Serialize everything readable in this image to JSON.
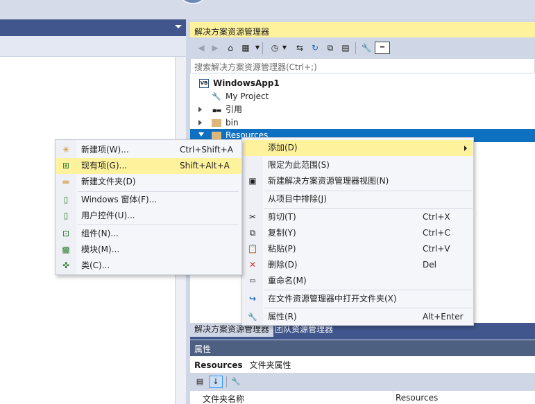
{
  "solution_explorer": {
    "title": "解决方案资源管理器",
    "search_placeholder": "搜索解决方案资源管理器(Ctrl+;)",
    "tree": {
      "project": "WindowsApp1",
      "project_badge": "VB",
      "items": [
        {
          "label": "My Project",
          "icon": "wrench-icon"
        },
        {
          "label": "引用",
          "icon": "references-icon"
        },
        {
          "label": "bin",
          "icon": "folder-icon"
        },
        {
          "label": "Resources",
          "icon": "folder-icon"
        }
      ]
    }
  },
  "bottom_tabs": [
    {
      "label": "解决方案资源管理器"
    },
    {
      "label": "团队资源管理器"
    }
  ],
  "properties": {
    "title": "属性",
    "object_name": "Resources",
    "object_type": "文件夹属性",
    "rows": [
      {
        "name": "文件夹名称",
        "value": "Resources"
      }
    ]
  },
  "context_menu": {
    "items": [
      {
        "label": "添加(D)",
        "shortcut": "",
        "icon": ""
      },
      {
        "label": "限定为此范围(S)",
        "shortcut": "",
        "icon": ""
      },
      {
        "label": "新建解决方案资源管理器视图(N)",
        "shortcut": "",
        "icon": "new-view-icon"
      },
      {
        "label": "从项目中排除(J)",
        "shortcut": "",
        "icon": ""
      },
      {
        "label": "剪切(T)",
        "shortcut": "Ctrl+X",
        "icon": "cut-icon"
      },
      {
        "label": "复制(Y)",
        "shortcut": "Ctrl+C",
        "icon": "copy-icon"
      },
      {
        "label": "粘贴(P)",
        "shortcut": "Ctrl+V",
        "icon": "paste-icon"
      },
      {
        "label": "删除(D)",
        "shortcut": "Del",
        "icon": "delete-icon"
      },
      {
        "label": "重命名(M)",
        "shortcut": "",
        "icon": "rename-icon"
      },
      {
        "label": "在文件资源管理器中打开文件夹(X)",
        "shortcut": "",
        "icon": "open-folder-icon"
      },
      {
        "label": "属性(R)",
        "shortcut": "Alt+Enter",
        "icon": "wrench-icon"
      }
    ]
  },
  "add_submenu": {
    "items": [
      {
        "label": "新建项(W)...",
        "shortcut": "Ctrl+Shift+A",
        "icon": "new-item-icon"
      },
      {
        "label": "现有项(G)...",
        "shortcut": "Shift+Alt+A",
        "icon": "existing-item-icon"
      },
      {
        "label": "新建文件夹(D)",
        "shortcut": "",
        "icon": "new-folder-icon"
      },
      {
        "label": "Windows 窗体(F)...",
        "shortcut": "",
        "icon": "windows-form-icon"
      },
      {
        "label": "用户控件(U)...",
        "shortcut": "",
        "icon": "user-control-icon"
      },
      {
        "label": "组件(N)...",
        "shortcut": "",
        "icon": "component-icon"
      },
      {
        "label": "模块(M)...",
        "shortcut": "",
        "icon": "module-icon"
      },
      {
        "label": "类(C)...",
        "shortcut": "",
        "icon": "class-icon"
      }
    ]
  },
  "colors": {
    "highlight": "#fff29d",
    "selection": "#0e70c0",
    "tool_window_header": "#40568d",
    "properties_header": "#4d6082"
  }
}
